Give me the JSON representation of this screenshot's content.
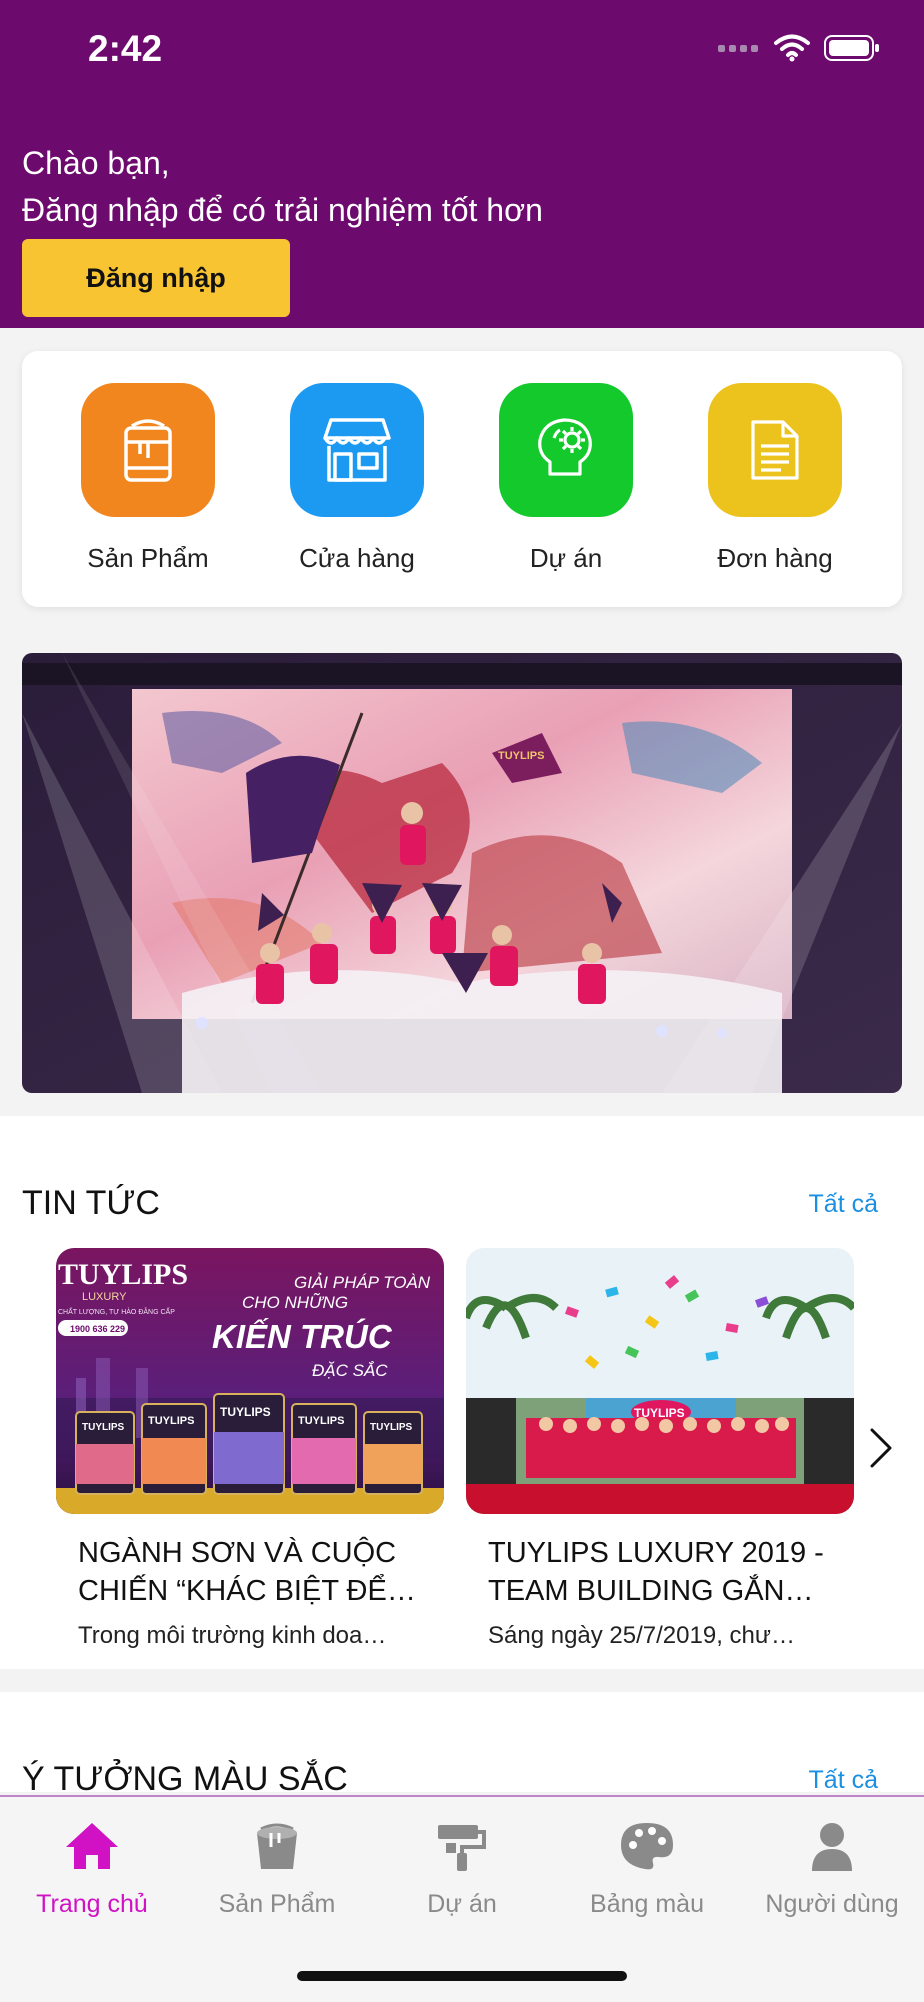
{
  "status_bar": {
    "time": "2:42"
  },
  "header": {
    "greeting": "Chào bạn,",
    "subtitle": "Đăng nhập để có trải nghiệm tốt hơn",
    "login_label": "Đăng nhập"
  },
  "quick_actions": [
    {
      "label": "Sản Phẩm",
      "icon": "paint-can-icon",
      "color": "#f2861e"
    },
    {
      "label": "Cửa hàng",
      "icon": "storefront-icon",
      "color": "#1c9af2"
    },
    {
      "label": "Dự án",
      "icon": "idea-gear-icon",
      "color": "#13c92b"
    },
    {
      "label": "Đơn hàng",
      "icon": "document-icon",
      "color": "#ecc31d"
    }
  ],
  "banner": {
    "icon": "event-photo",
    "flag_text": "TUYLIPS"
  },
  "news": {
    "title": "TIN TỨC",
    "see_all": "Tất cả",
    "items": [
      {
        "title": "NGÀNH SƠN VÀ CUỘC CHIẾN “KHÁC BIỆT ĐỂ…",
        "desc": "Trong môi trường kinh doa…",
        "img": {
          "brand": "TUYLIPS",
          "sub": "LUXURY",
          "tagline": "CHẤT LƯỢNG, TỰ HÀO ĐẲNG CẤP",
          "hotline": "1900 636 229",
          "line1": "GIẢI PHÁP TOÀN",
          "line2": "CHO NHỮNG",
          "line3": "KIẾN TRÚC",
          "line4": "ĐẶC SẮC",
          "can_label": "TUYLIPS"
        }
      },
      {
        "title": "TUYLIPS LUXURY 2019 - TEAM BUILDING GẮN…",
        "desc": "Sáng ngày 25/7/2019, chư…",
        "img": {
          "banner_text": "TUYLIPS"
        }
      }
    ]
  },
  "ideas": {
    "title": "Ý TƯỞNG MÀU SẮC",
    "see_all": "Tất cả"
  },
  "tabs": [
    {
      "label": "Trang chủ",
      "icon": "home-icon",
      "active": true
    },
    {
      "label": "Sản Phẩm",
      "icon": "paint-bucket-icon",
      "active": false
    },
    {
      "label": "Dự án",
      "icon": "paint-roller-icon",
      "active": false
    },
    {
      "label": "Bảng màu",
      "icon": "palette-icon",
      "active": false
    },
    {
      "label": "Người dùng",
      "icon": "user-icon",
      "active": false
    }
  ],
  "colors": {
    "header_bg": "#6d0a6e",
    "login_button": "#f8c432",
    "link": "#1a8fe3",
    "tab_active": "#d012c4",
    "tab_inactive": "#8a8a8a"
  }
}
